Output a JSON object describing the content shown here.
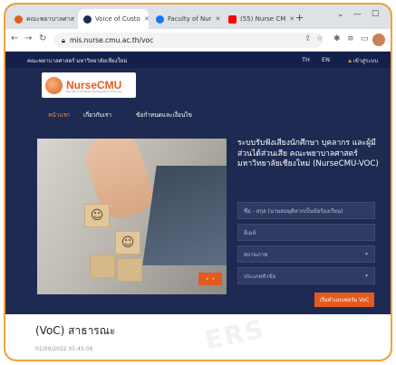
{
  "browser": {
    "tabs": [
      {
        "label": "คณะพยาบาลศาส",
        "favicon_color": "#e35e1f",
        "active": false
      },
      {
        "label": "Voice of Custo",
        "favicon_color": "#1e2a52",
        "active": true
      },
      {
        "label": "Faculty of Nur",
        "favicon_color": "#1877f2",
        "active": false
      },
      {
        "label": "(55) Nurse CM",
        "favicon_color": "#ff0000",
        "active": false
      }
    ],
    "url": "mis.nurse.cmu.ac.th/voc"
  },
  "site": {
    "university": "คณะพยาบาลศาสตร์ มหาวิทยาลัยเชียงใหม่",
    "lang_th": "TH",
    "lang_en": "EN",
    "login": "เข้าสู่ระบบ",
    "logo_text": "NurseCMU",
    "logo_subtext": "Faculty of Nursing, Chiang Mai University",
    "nav": [
      "หน้าแรก",
      "เกี่ยวกับเรา",
      "ข้อกำหนดและเงื่อนไข"
    ]
  },
  "hero": {
    "title": "ระบบรับฟังเสียงนักศึกษา บุคลากร และผู้มีส่วนได้ส่วนเสีย คณะพยาบาลศาสตร์ มหาวิทยาลัยเชียงใหม่ (NurseCMU-VOC)",
    "fields": [
      {
        "placeholder": "ชื่อ - สกุล (นามสมมุติหากเป็นข้อร้องเรียน)",
        "type": "text"
      },
      {
        "placeholder": "อีเมล์",
        "type": "text"
      },
      {
        "placeholder": "สถานภาพ",
        "type": "select"
      },
      {
        "placeholder": "ประเภทหัวข้อ",
        "type": "select"
      }
    ],
    "submit_label": "เริ่มทำแบบฟอร์ม VoC",
    "pager": {
      "prev": "‹",
      "next": "›"
    }
  },
  "content": {
    "heading": "(VoC) สาธารณะ",
    "date": "01/09/2022 05:45:08",
    "watermark": "ERS"
  },
  "colors": {
    "accent": "#e35a1f",
    "navy": "#1e2a52",
    "frame": "#f0a53a"
  }
}
